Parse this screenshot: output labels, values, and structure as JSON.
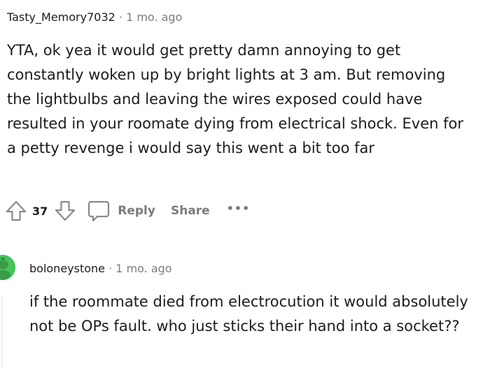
{
  "comments": [
    {
      "username": "Tasty_Memory7032",
      "separator": "·",
      "timestamp": "1 mo. ago",
      "body": "YTA, ok yea it would get pretty damn annoying to get constantly woken up by bright lights at 3 am. But removing the lightbulbs and leaving the wires exposed could have resulted in your roomate dying from electrical shock. Even for a petty revenge i would say this went a bit too far",
      "vote_count": "37",
      "reply_label": "Reply",
      "share_label": "Share",
      "more_label": "•••"
    },
    {
      "username": "boloneystone",
      "separator": "·",
      "timestamp": "1 mo. ago",
      "body": "if the roommate died from electrocution it would absolutely not be OPs fault. who just sticks their hand into a socket??",
      "avatar_color": "#46c25a"
    }
  ],
  "colors": {
    "text_primary": "#1c1c1c",
    "text_muted": "#7c7c7c",
    "thread_line": "#edeff1",
    "avatar_green": "#46c25a"
  },
  "icons": [
    "upvote-icon",
    "downvote-icon",
    "comment-bubble-icon",
    "more-options-icon",
    "avatar-icon"
  ]
}
